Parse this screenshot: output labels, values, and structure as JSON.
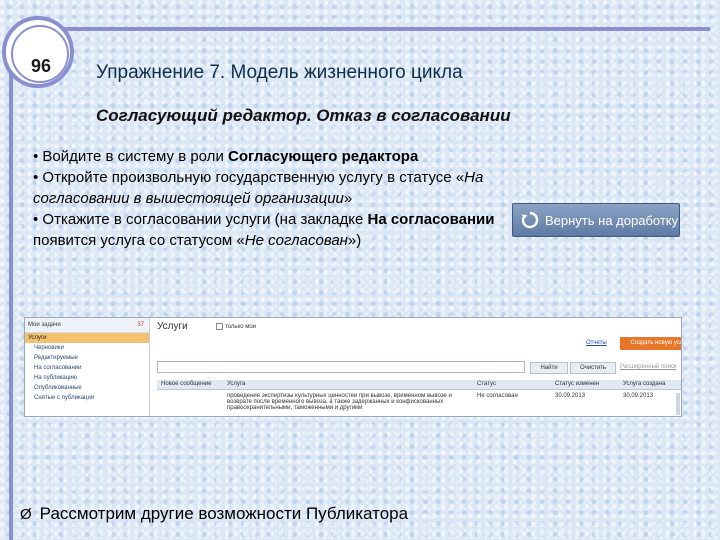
{
  "slide": {
    "number": "96",
    "title": "Упражнение 7. Модель жизненного цикла",
    "subtitle": "Согласующий редактор. Отказ в согласовании"
  },
  "bullets": [
    {
      "prefix": "• Войдите в систему в роли ",
      "bold": "Согласующего редактора"
    },
    {
      "prefix": "• Откройте произвольную государственную услугу в статусе «",
      "italic": "На согласовании в вышестоящей организации",
      "suffix": "»"
    },
    {
      "prefix": "• Откажите в согласовании услуги (на закладке ",
      "bold": "На согласовании",
      "middle": " появится услуга со статусом «",
      "italic": "Не согласован",
      "suffix": "»)"
    }
  ],
  "return_button": {
    "label": "Вернуть на доработку",
    "icon": "undo-arrow-icon"
  },
  "app": {
    "sidebar": {
      "header": "Мои задачи",
      "count": "37",
      "items": [
        {
          "label": "Услуги",
          "active": true,
          "sub": false
        },
        {
          "label": "Черновики",
          "active": false,
          "sub": true
        },
        {
          "label": "Редактируемые",
          "active": false,
          "sub": true
        },
        {
          "label": "На согласовании",
          "active": false,
          "sub": true
        },
        {
          "label": "На публикацию",
          "active": false,
          "sub": true
        },
        {
          "label": "Опубликованные",
          "active": false,
          "sub": true
        },
        {
          "label": "Снятые с публикации",
          "active": false,
          "sub": true
        }
      ]
    },
    "main": {
      "title": "Услуги",
      "only_mine": "только мои",
      "report_link": "Отчеты",
      "create_button": "Создать новую услугу",
      "search_value": "",
      "find_button": "Найти",
      "clear_button": "Очистить",
      "advanced_search": "Расширенный поиск",
      "columns": [
        "Новое сообщение",
        "Услуга",
        "Статус",
        "Статус изменен",
        "Услуга создана"
      ],
      "rows": [
        {
          "message": "",
          "service": "проведение экспертизы культурных ценностей при вывозе, временном вывозе и возврате после временного вывоза, а также задержанных и конфискованных правоохранительными, таможенными и другими",
          "status": "Не согласован",
          "changed": "30.09.2013",
          "created": "30.09.2013"
        }
      ]
    }
  },
  "footer": {
    "marker": "Ø",
    "text": "Рассмотрим другие возможности Публикатора"
  }
}
